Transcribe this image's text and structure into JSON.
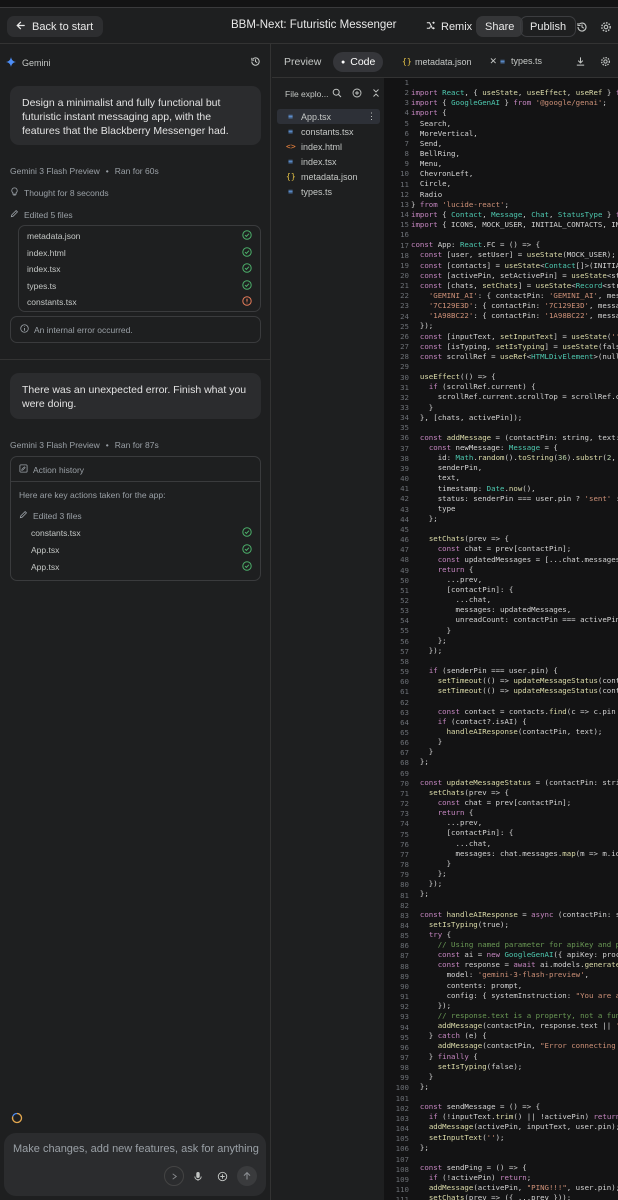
{
  "header": {
    "back_label": "Back to start",
    "title": "BBM-Next: Futuristic Messenger",
    "remix_label": "Remix",
    "share_label": "Share",
    "publish_label": "Publish"
  },
  "chat": {
    "assistant_name": "Gemini",
    "prompt1": "Design a minimalist and fully functional but futuristic instant messaging app, with the features that the Blackberry Messenger had.",
    "run1": {
      "model": "Gemini 3 Flash Preview",
      "sep": "•",
      "duration": "Ran for 60s"
    },
    "thought": "Thought for 8 seconds",
    "edited1": "Edited 5 files",
    "files1": [
      {
        "name": "metadata.json",
        "status": "ok"
      },
      {
        "name": "index.html",
        "status": "ok"
      },
      {
        "name": "index.tsx",
        "status": "ok"
      },
      {
        "name": "types.ts",
        "status": "ok"
      },
      {
        "name": "constants.tsx",
        "status": "error"
      }
    ],
    "error_msg": "An internal error occurred.",
    "prompt2": "There was an unexpected error. Finish what you were doing.",
    "run2": {
      "model": "Gemini 3 Flash Preview",
      "sep": "•",
      "duration": "Ran for 87s"
    },
    "action_history": {
      "title": "Action history",
      "intro": "Here are key actions taken for the app:",
      "edited": "Edited 3 files",
      "files": [
        {
          "name": "constants.tsx"
        },
        {
          "name": "App.tsx"
        },
        {
          "name": "App.tsx"
        }
      ]
    },
    "composer_placeholder": "Make changes, add new features, ask for anything"
  },
  "tabs": {
    "preview": "Preview",
    "code": "Code",
    "file_tabs": [
      {
        "name": "metadata.json"
      },
      {
        "name": "types.ts"
      }
    ]
  },
  "explorer": {
    "title": "File explo...",
    "files": [
      {
        "name": "App.tsx",
        "type": "tsx",
        "selected": true
      },
      {
        "name": "constants.tsx",
        "type": "tsx"
      },
      {
        "name": "index.html",
        "type": "html"
      },
      {
        "name": "index.tsx",
        "type": "tsx"
      },
      {
        "name": "metadata.json",
        "type": "json"
      },
      {
        "name": "types.ts",
        "type": "ts"
      }
    ]
  },
  "code": {
    "first_line": 1,
    "lines": [
      "",
      "import React, { useState, useEffect, useRef } from 'react';",
      "import { GoogleGenAI } from '@google/genai';",
      "import {",
      "  Search,",
      "  MoreVertical,",
      "  Send,",
      "  BellRing,",
      "  Menu,",
      "  ChevronLeft,",
      "  Circle,",
      "  Radio",
      "} from 'lucide-react';",
      "import { Contact, Message, Chat, StatusType } from './types';",
      "import { ICONS, MOCK_USER, INITIAL_CONTACTS, INITIAL_CHATS } from './constants';",
      "",
      "const App: React.FC = () => {",
      "  const [user, setUser] = useState(MOCK_USER);",
      "  const [contacts] = useState<Contact[]>(INITIAL_CONTACTS);",
      "  const [activePin, setActivePin] = useState<string | null>(null);",
      "  const [chats, setChats] = useState<Record<string, Chat>>({",
      "    'GEMINI_AI': { contactPin: 'GEMINI_AI', messages: [], unreadCount: 0 },",
      "    '7C129E3D': { contactPin: '7C129E3D', messages: [], unreadCount: 0 },",
      "    '1A98BC22': { contactPin: '1A98BC22', messages: [], unreadCount: 0 },",
      "  });",
      "  const [inputText, setInputText] = useState('');",
      "  const [isTyping, setIsTyping] = useState(false);",
      "  const scrollRef = useRef<HTMLDivElement>(null);",
      "",
      "  useEffect(() => {",
      "    if (scrollRef.current) {",
      "      scrollRef.current.scrollTop = scrollRef.current.scrollHeight;",
      "    }",
      "  }, [chats, activePin]);",
      "",
      "  const addMessage = (contactPin: string, text: string, senderPin: string) => {",
      "    const newMessage: Message = {",
      "      id: Math.random().toString(36).substr(2, 9),",
      "      senderPin,",
      "      text,",
      "      timestamp: Date.now(),",
      "      status: senderPin === user.pin ? 'sent' : 'read',",
      "      type",
      "    };",
      "",
      "    setChats(prev => {",
      "      const chat = prev[contactPin];",
      "      const updatedMessages = [...chat.messages, newMessage];",
      "      return {",
      "        ...prev,",
      "        [contactPin]: {",
      "          ...chat,",
      "          messages: updatedMessages,",
      "          unreadCount: contactPin === activePin ? 0 : chat.unreadCount + 1",
      "        }",
      "      };",
      "    });",
      "",
      "    if (senderPin === user.pin) {",
      "      setTimeout(() => updateMessageStatus(contactPin, newMessage.id, 'D'), 1000);",
      "      setTimeout(() => updateMessageStatus(contactPin, newMessage.id, 'R'), 2500);",
      "",
      "      const contact = contacts.find(c => c.pin === contactPin);",
      "      if (contact?.isAI) {",
      "        handleAIResponse(contactPin, text);",
      "      }",
      "    }",
      "  };",
      "",
      "  const updateMessageStatus = (contactPin: string, msgId: string, status: string) => {",
      "    setChats(prev => {",
      "      const chat = prev[contactPin];",
      "      return {",
      "        ...prev,",
      "        [contactPin]: {",
      "          ...chat,",
      "          messages: chat.messages.map(m => m.id === msgId ? { ...m, status } : m)",
      "        }",
      "      };",
      "    });",
      "  };",
      "",
      "  const handleAIResponse = async (contactPin: string, prompt: string) => {",
      "    setIsTyping(true);",
      "    try {",
      "      // Using named parameter for apiKey and process.env.API_KEY directly",
      "      const ai = new GoogleGenAI({ apiKey: process.env.API_KEY });",
      "      const response = await ai.models.generateContent({",
      "        model: 'gemini-3-flash-preview',",
      "        contents: prompt,",
      "        config: { systemInstruction: \"You are a futuristic AI assistant\" }",
      "      });",
      "      // response.text is a property, not a function",
      "      addMessage(contactPin, response.text || '', contactPin);",
      "    } catch (e) {",
      "      addMessage(contactPin, \"Error connecting to AI\", contactPin);",
      "    } finally {",
      "      setIsTyping(false);",
      "    }",
      "  };",
      "",
      "  const sendMessage = () => {",
      "    if (!inputText.trim() || !activePin) return;",
      "    addMessage(activePin, inputText, user.pin);",
      "    setInputText('');",
      "  };",
      "",
      "  const sendPing = () => {",
      "    if (!activePin) return;",
      "    addMessage(activePin, \"PING!!!\", user.pin);",
      "    setChats(prev => ({ ...prev }));"
    ]
  }
}
